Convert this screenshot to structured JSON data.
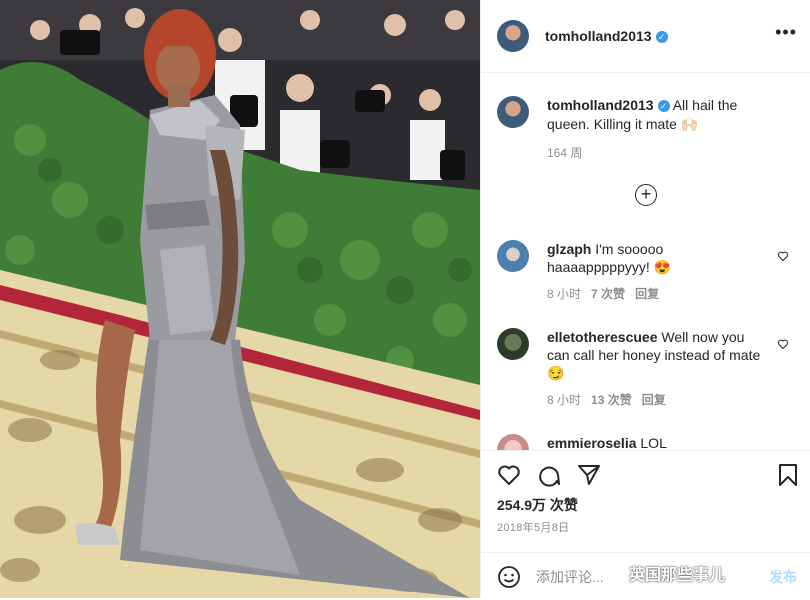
{
  "header": {
    "username": "tomholland2013",
    "more": "•••"
  },
  "caption": {
    "username": "tomholland2013",
    "text": "All hail the queen. Killing it mate 🙌🏻",
    "age": "164 周"
  },
  "comments": [
    {
      "username": "glzaph",
      "text": "I'm sooooo haaaapppppyyy! 😍",
      "age": "8 小时",
      "likes": "7 次赞",
      "reply": "回复"
    },
    {
      "username": "elletotherescuee",
      "text": "Well now you can call her honey instead of mate 😏",
      "age": "8 小时",
      "likes": "13 次赞",
      "reply": "回复"
    },
    {
      "username": "emmieroselia",
      "text": "LOL"
    }
  ],
  "actions": {
    "likes": "254.9万 次赞",
    "date": "2018年5月8日",
    "add_comment_placeholder": "添加评论...",
    "post_label": "发布",
    "watermark": "英国那些事儿"
  }
}
